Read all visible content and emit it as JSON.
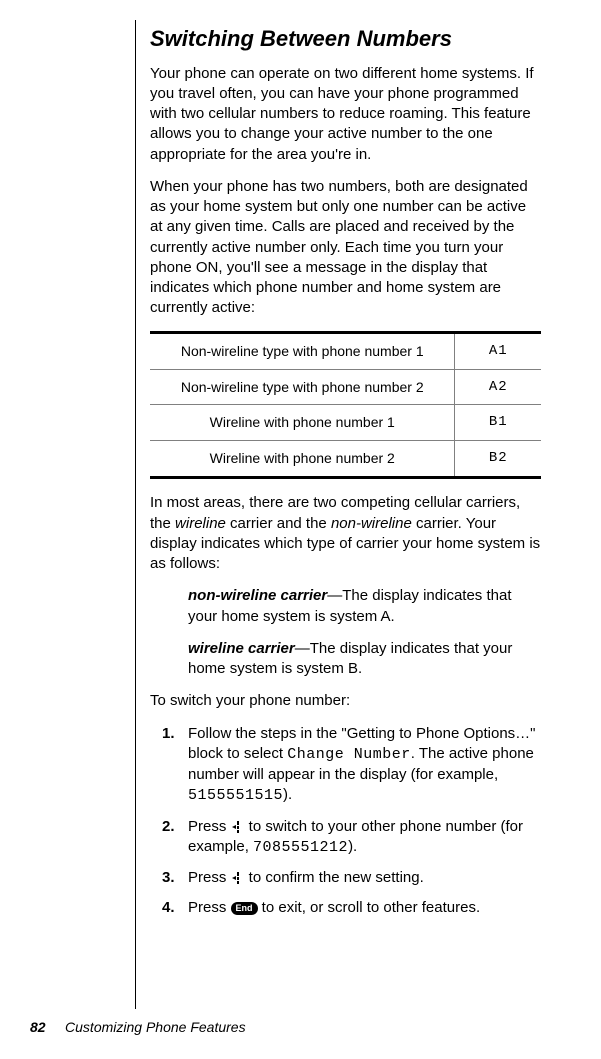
{
  "heading": "Switching Between Numbers",
  "para1": "Your phone can operate on two different home systems. If you travel often, you can have your phone programmed with two cellular numbers to reduce roaming. This feature allows you to change your active number to the one appropriate for the area you're in.",
  "para2": "When your phone has two numbers, both are designated as your home system but only one number can be active at any given time. Calls are placed and received by the currently active number only. Each time you turn your phone ON, you'll see a message in the display that indicates which phone number and home system are currently active:",
  "table": [
    {
      "desc": "Non-wireline type with phone number 1",
      "code": "A1"
    },
    {
      "desc": "Non-wireline type with phone number 2",
      "code": "A2"
    },
    {
      "desc": "Wireline with phone number 1",
      "code": "B1"
    },
    {
      "desc": "Wireline with phone number 2",
      "code": "B2"
    }
  ],
  "para3_a": "In most areas, there are two competing cellular carriers, the ",
  "para3_w1": "wireline",
  "para3_b": " carrier and the ",
  "para3_w2": "non-wireline",
  "para3_c": " carrier. Your display indicates which type of carrier your home system is as follows:",
  "def1_term": "non-wireline carrier",
  "def1_text": "—The display indicates that your home system is system A.",
  "def2_term": "wireline carrier",
  "def2_text": "—The display indicates that your home system is system B.",
  "para4": "To switch your phone number:",
  "step1_a": "Follow the steps in the \"Getting to Phone Options…\" block to select ",
  "step1_code1": "Change Number",
  "step1_b": ". The active phone number will appear in the display (for example, ",
  "step1_code2": "5155551515",
  "step1_c": ").",
  "step2_a": "Press ",
  "step2_b": " to switch to your other phone number (for example, ",
  "step2_code": "7085551212",
  "step2_c": ").",
  "step3_a": "Press ",
  "step3_b": " to confirm the new setting.",
  "step4_a": "Press ",
  "step4_key": "End",
  "step4_b": " to exit, or scroll to other features.",
  "footer_page": "82",
  "footer_label": "Customizing Phone Features"
}
